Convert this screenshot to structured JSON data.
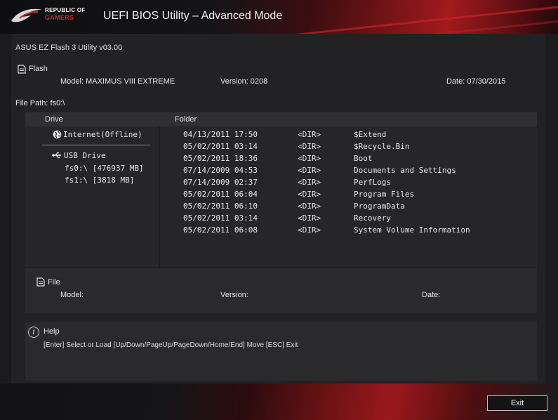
{
  "header": {
    "logo_line1": "REPUBLIC OF",
    "logo_line2": "GAMERS",
    "title": "UEFI BIOS Utility – Advanced Mode"
  },
  "utility_version": "ASUS EZ Flash 3 Utility v03.00",
  "flash": {
    "label": "Flash",
    "model": "Model:  MAXIMUS VIII EXTREME",
    "version": "Version:  0208",
    "date": "Date: 07/30/2015"
  },
  "file_path": "File Path: fs0:\\",
  "columns": {
    "drive": "Drive",
    "folder": "Folder"
  },
  "drives": {
    "internet": "Internet(Offline)",
    "usb": "USB Drive",
    "fs0": "fs0:\\ [476937 MB]",
    "fs1": "fs1:\\ [3818 MB]"
  },
  "folders": [
    {
      "date": "04/13/2011 17:50",
      "type": "<DIR>",
      "name": "$Extend"
    },
    {
      "date": "05/02/2011 03:14",
      "type": "<DIR>",
      "name": "$Recycle.Bin"
    },
    {
      "date": "05/02/2011 18:36",
      "type": "<DIR>",
      "name": "Boot"
    },
    {
      "date": "07/14/2009 04:53",
      "type": "<DIR>",
      "name": "Documents and Settings"
    },
    {
      "date": "07/14/2009 02:37",
      "type": "<DIR>",
      "name": "PerfLogs"
    },
    {
      "date": "05/02/2011 06:04",
      "type": "<DIR>",
      "name": "Program Files"
    },
    {
      "date": "05/02/2011 06:10",
      "type": "<DIR>",
      "name": "ProgramData"
    },
    {
      "date": "05/02/2011 03:14",
      "type": "<DIR>",
      "name": "Recovery"
    },
    {
      "date": "05/02/2011 06:08",
      "type": "<DIR>",
      "name": "System Volume Information"
    }
  ],
  "file": {
    "label": "File",
    "model": "Model:",
    "version": "Version:",
    "date": "Date:"
  },
  "help": {
    "label": "Help",
    "text": "[Enter] Select or Load  [Up/Down/PageUp/PageDown/Home/End] Move  [ESC] Exit"
  },
  "exit_label": "Exit",
  "colors": {
    "accent": "#b81c20",
    "panel": "#222225"
  },
  "icons": [
    "rog-logo-icon",
    "document-icon",
    "globe-icon",
    "usb-icon",
    "info-icon"
  ]
}
